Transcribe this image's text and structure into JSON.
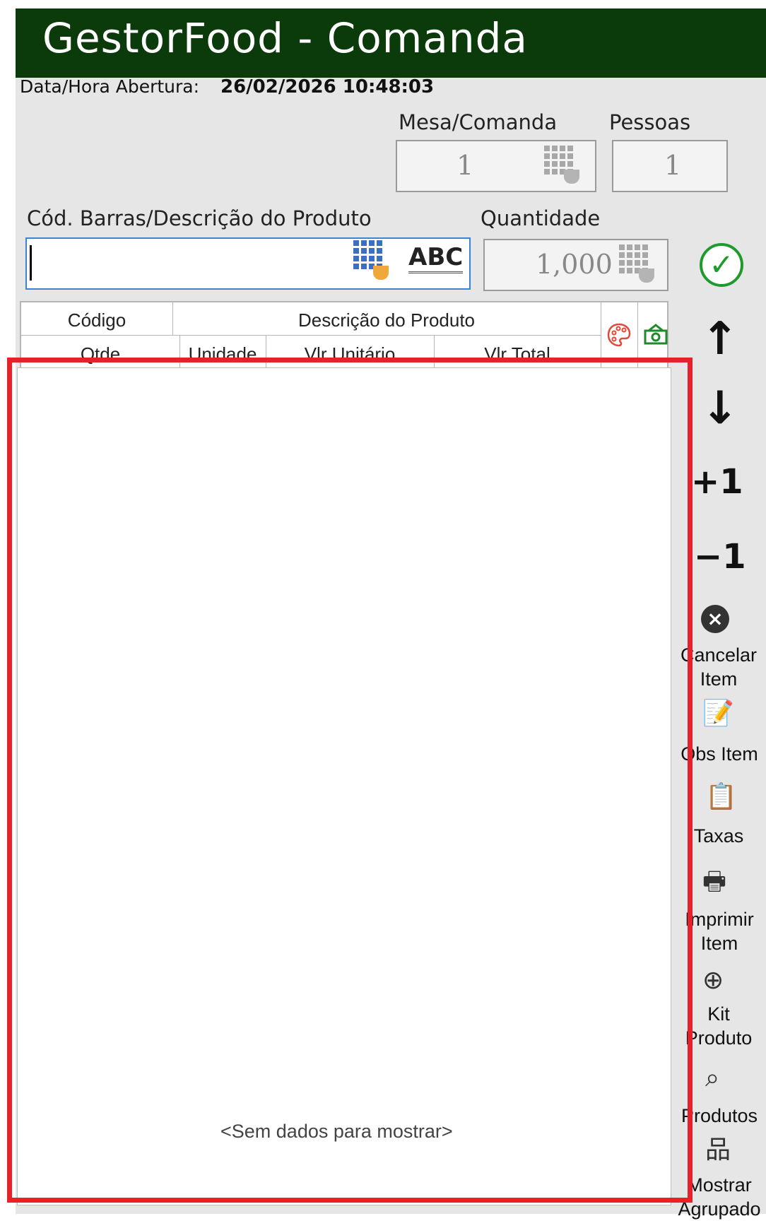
{
  "app": {
    "title": "GestorFood - Comanda",
    "open_label": "Data/Hora Abertura:",
    "open_value": "26/02/2026 10:48:03"
  },
  "table_info": {
    "mesa_label": "Mesa/Comanda",
    "mesa_value": "1",
    "pessoas_label": "Pessoas",
    "pessoas_value": "1"
  },
  "product_entry": {
    "search_label": "Cód. Barras/Descrição do Produto",
    "search_value": "",
    "abc_label": "ABC",
    "qty_label": "Quantidade",
    "qty_value": "1,000"
  },
  "grid": {
    "columns_row1": [
      "Código",
      "Descrição do Produto"
    ],
    "columns_row2": [
      "Qtde",
      "Unidade",
      "Vlr Unitário",
      "Vlr Total"
    ],
    "empty_message": "<Sem dados para mostrar>"
  },
  "toolbar": {
    "plus_one": "+1",
    "minus_one": "−1",
    "cancel_item": [
      "Cancelar",
      "Item"
    ],
    "obs_item": "Obs Item",
    "taxas": "Taxas",
    "print_item": [
      "Imprimir",
      "Item"
    ],
    "kit_produto": [
      "Kit",
      "Produto"
    ],
    "produtos": "Produtos",
    "mostrar_agrupado": [
      "Mostrar",
      "Agrupado"
    ]
  },
  "colors": {
    "title_bar": "#0b3a0b",
    "highlight": "#e8202a",
    "confirm": "#1f9a2c",
    "focus_border": "#3c83d0"
  },
  "icons": [
    "keypad-icon",
    "abc-keyboard-icon",
    "confirm-check-icon",
    "palette-icon",
    "cash-icon",
    "arrow-up-icon",
    "arrow-down-icon",
    "cancel-circle-icon",
    "edit-note-icon",
    "clipboard-icon",
    "printer-icon",
    "kit-add-icon",
    "search-icon",
    "hierarchy-icon"
  ]
}
